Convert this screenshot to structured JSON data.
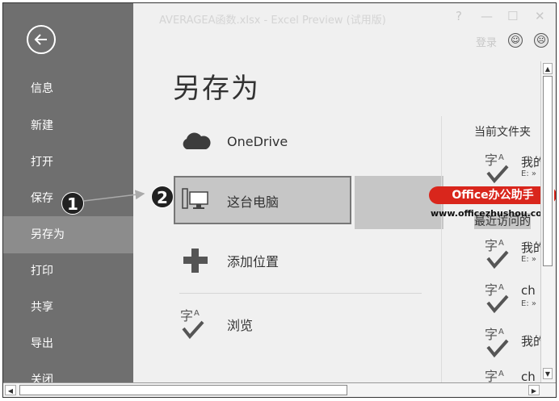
{
  "window": {
    "title": "AVERAGEA函数.xlsx - Excel Preview (试用版)",
    "help": "?",
    "minimize": "—",
    "maximize": "☐",
    "close": "✕",
    "login": "登录",
    "smile": "☺",
    "frown": "☹"
  },
  "sidebar": {
    "items": [
      "信息",
      "新建",
      "打开",
      "保存",
      "另存为",
      "打印",
      "共享",
      "导出",
      "关闭"
    ],
    "active_index": 4
  },
  "page_title": "另存为",
  "locations": [
    {
      "label": "OneDrive",
      "icon": "cloud-icon"
    },
    {
      "label": "这台电脑",
      "icon": "computer-icon"
    },
    {
      "label": "添加位置",
      "icon": "plus-icon"
    },
    {
      "label": "浏览",
      "icon": "browse-icon"
    }
  ],
  "selected_location": 1,
  "current_folder_header": "当前文件夹",
  "recent_header": "最近访问的",
  "current_folders": [
    {
      "name": "我的",
      "path": "E: »"
    }
  ],
  "recent_folders": [
    {
      "name": "我的",
      "path": "E: »"
    },
    {
      "name": "ch",
      "path": "E: »"
    },
    {
      "name": "我的",
      "path": ""
    },
    {
      "name": "ch",
      "path": ""
    }
  ],
  "watermark": {
    "brand": "Office办公助手",
    "url": "www.officezhushou.com"
  },
  "annotations": {
    "step1": "1",
    "step2": "2"
  },
  "colors": {
    "sidebar": "#6f6f6f",
    "sidebar_active": "#8c8c8c",
    "selected": "#c6c6c6",
    "brand_red": "#d9261c"
  }
}
